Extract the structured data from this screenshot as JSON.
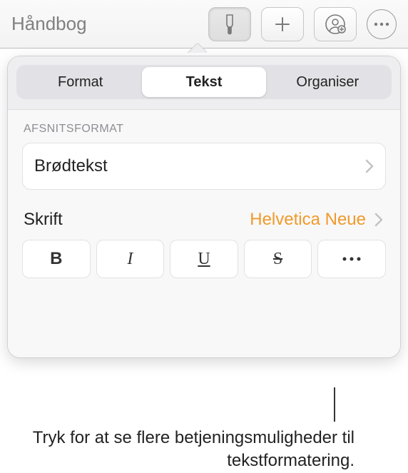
{
  "toolbar": {
    "title": "Håndbog"
  },
  "popover": {
    "tabs": {
      "format": "Format",
      "text": "Tekst",
      "organize": "Organiser"
    },
    "paragraph": {
      "section_label": "AFSNITSFORMAT",
      "style_name": "Brødtekst"
    },
    "font": {
      "label": "Skrift",
      "name": "Helvetica Neue"
    },
    "style_buttons": {
      "bold": "B",
      "italic": "I",
      "underline": "U",
      "strike": "S",
      "more": "•••"
    }
  },
  "callout": {
    "text": "Tryk for at se flere betjeningsmuligheder til tekstformatering."
  }
}
